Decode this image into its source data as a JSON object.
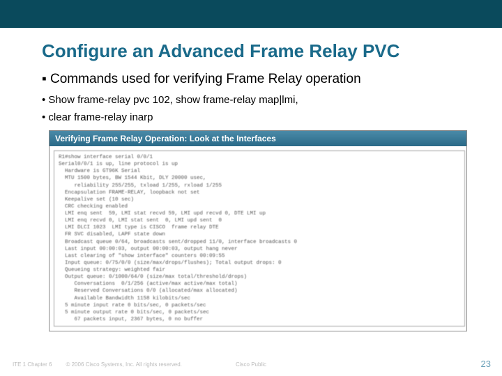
{
  "slide": {
    "title": "Configure an Advanced Frame Relay PVC",
    "bullet_main": "Commands used for verifying Frame Relay operation",
    "bullet_sub1": "Show frame-relay pvc 102, show frame-relay map|lmi,",
    "bullet_sub2": "clear frame-relay inarp"
  },
  "screenshot": {
    "header": "Verifying Frame Relay Operation: Look at the Interfaces",
    "cli": "R1#show interface serial 0/0/1\nSerial0/0/1 is up, line protocol is up\n  Hardware is GT96K Serial\n  MTU 1500 bytes, BW 1544 Kbit, DLY 20000 usec,\n     reliability 255/255, txload 1/255, rxload 1/255\n  Encapsulation FRAME-RELAY, loopback not set\n  Keepalive set (10 sec)\n  CRC checking enabled\n  LMI enq sent  59, LMI stat recvd 59, LMI upd recvd 0, DTE LMI up\n  LMI enq recvd 0, LMI stat sent  0, LMI upd sent  0\n  LMI DLCI 1023  LMI type is CISCO  frame relay DTE\n  FR SVC disabled, LAPF state down\n  Broadcast queue 0/64, broadcasts sent/dropped 11/0, interface broadcasts 0\n  Last input 00:00:03, output 00:00:03, output hang never\n  Last clearing of \"show interface\" counters 00:09:55\n  Input queue: 0/75/0/0 (size/max/drops/flushes); Total output drops: 0\n  Queueing strategy: weighted fair\n  Output queue: 0/1000/64/0 (size/max total/threshold/drops)\n     Conversations  0/1/256 (active/max active/max total)\n     Reserved Conversations 0/0 (allocated/max allocated)\n     Available Bandwidth 1158 kilobits/sec\n  5 minute input rate 0 bits/sec, 0 packets/sec\n  5 minute output rate 0 bits/sec, 0 packets/sec\n     67 packets input, 2367 bytes, 0 no buffer"
  },
  "footer": {
    "left": "ITE 1 Chapter 6",
    "copyright": "© 2006 Cisco Systems, Inc. All rights reserved.",
    "center": "Cisco Public",
    "page": "23"
  }
}
